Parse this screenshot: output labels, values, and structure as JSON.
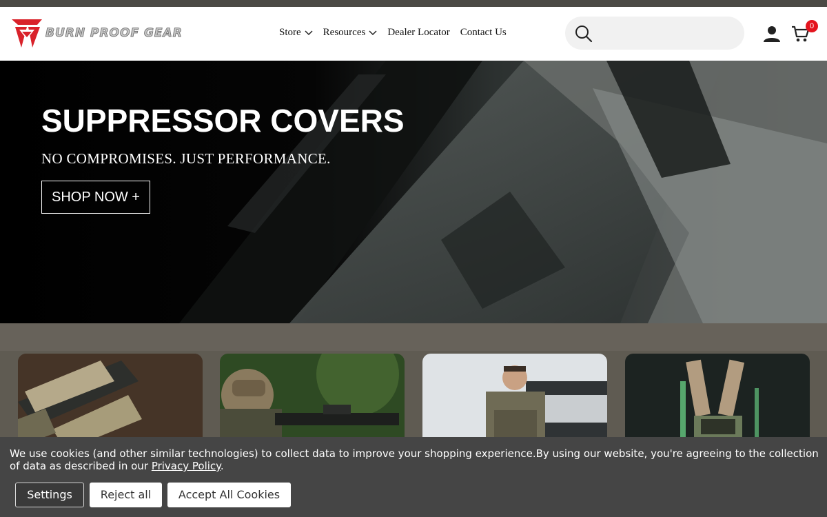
{
  "brand": {
    "name": "BURN PROOF GEAR"
  },
  "nav": {
    "items": [
      {
        "label": "Store",
        "dropdown": true
      },
      {
        "label": "Resources",
        "dropdown": true
      },
      {
        "label": "Dealer Locator",
        "dropdown": false
      },
      {
        "label": "Contact Us",
        "dropdown": false
      }
    ]
  },
  "search": {
    "placeholder": ""
  },
  "cart": {
    "count": "0"
  },
  "hero": {
    "title": "SUPPRESSOR COVERS",
    "subtitle": "NO COMPROMISES. JUST PERFORMANCE.",
    "cta": "SHOP NOW +"
  },
  "cookie": {
    "text": "We use cookies (and other similar technologies) to collect data to improve your shopping experience.By using our website, you're agreeing to the collection of data as described in our ",
    "link": "Privacy Policy",
    "period": ".",
    "settings": "Settings",
    "reject": "Reject all",
    "accept": "Accept All Cookies"
  },
  "colors": {
    "accent": "#e4141e",
    "brand_red": "#d9222a",
    "banner": "#454545"
  }
}
